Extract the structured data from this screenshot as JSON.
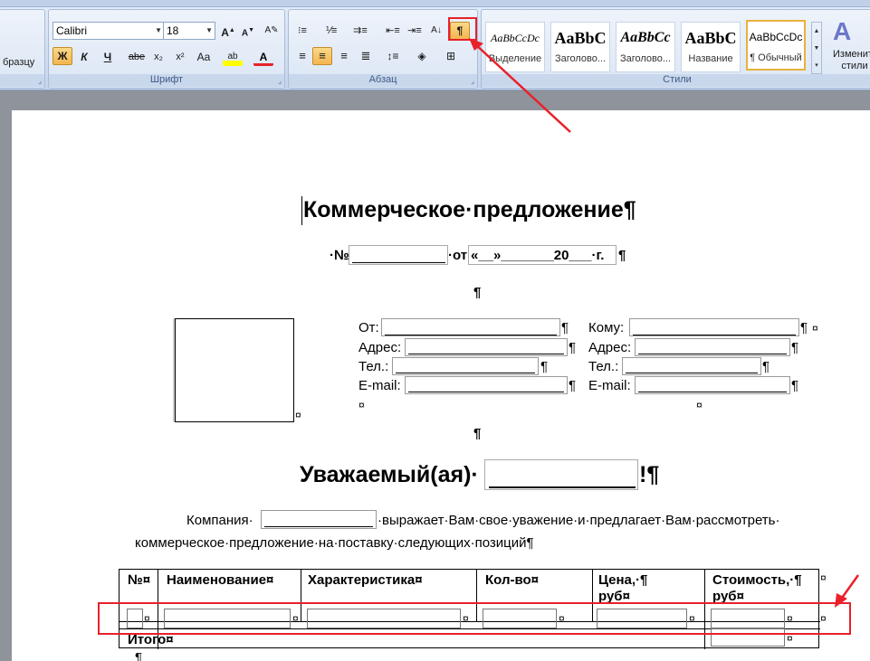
{
  "ribbon": {
    "clipboard_partial": "бразцу",
    "font_group": {
      "label": "Шрифт",
      "font_name": "Calibri",
      "font_size": "18",
      "bold": "Ж",
      "italic": "К",
      "underline": "Ч",
      "strike": "abe",
      "subscript": "x₂",
      "superscript": "x²",
      "case": "Aa"
    },
    "paragraph_group": {
      "label": "Абзац",
      "show_marks": "¶"
    },
    "styles_group": {
      "label": "Стили",
      "styles": [
        {
          "sample": "AaBbCcDc",
          "name": "Выделение"
        },
        {
          "sample": "AaBbC",
          "name": "Заголово..."
        },
        {
          "sample": "AaBbCc",
          "name": "Заголово..."
        },
        {
          "sample": "AaBbC",
          "name": "Название"
        },
        {
          "sample": "AaBbCcDc",
          "name": "¶ Обычный"
        }
      ],
      "change_styles": "Изменить стили"
    }
  },
  "document": {
    "title": "Коммерческое·предложение¶",
    "number_line_prefix": "·№",
    "number_line_middle": "·от",
    "number_line_date": "«__»_______20___·г.",
    "number_line_end": "¶",
    "empty_para": "¶",
    "from_label": "От:",
    "address_label": "Адрес:",
    "phone_label": "Тел.:",
    "email_label": "E-mail:",
    "to_label": "Кому:",
    "cell_end": "¤",
    "para_mark": "¶",
    "greeting": "Уважаемый(ая)·",
    "greeting_end": "!¶",
    "intro_company": "Компания·",
    "intro_rest": "·выражает·Вам·свое·уважение·и·предлагает·Вам·рассмотреть·",
    "intro_line2": "коммерческое·предложение·на·поставку·следующих·позиций¶",
    "table_headers": [
      "№¤",
      "Наименование¤",
      "Характеристика¤",
      "Кол-во¤",
      "Цена,·¶",
      "Стоимость,·¶"
    ],
    "table_headers_line2": [
      "руб¤",
      "руб¤"
    ],
    "total_label": "Итого¤"
  },
  "colors": {
    "annotation": "#e8212b",
    "active_button": "#f3b54f"
  }
}
